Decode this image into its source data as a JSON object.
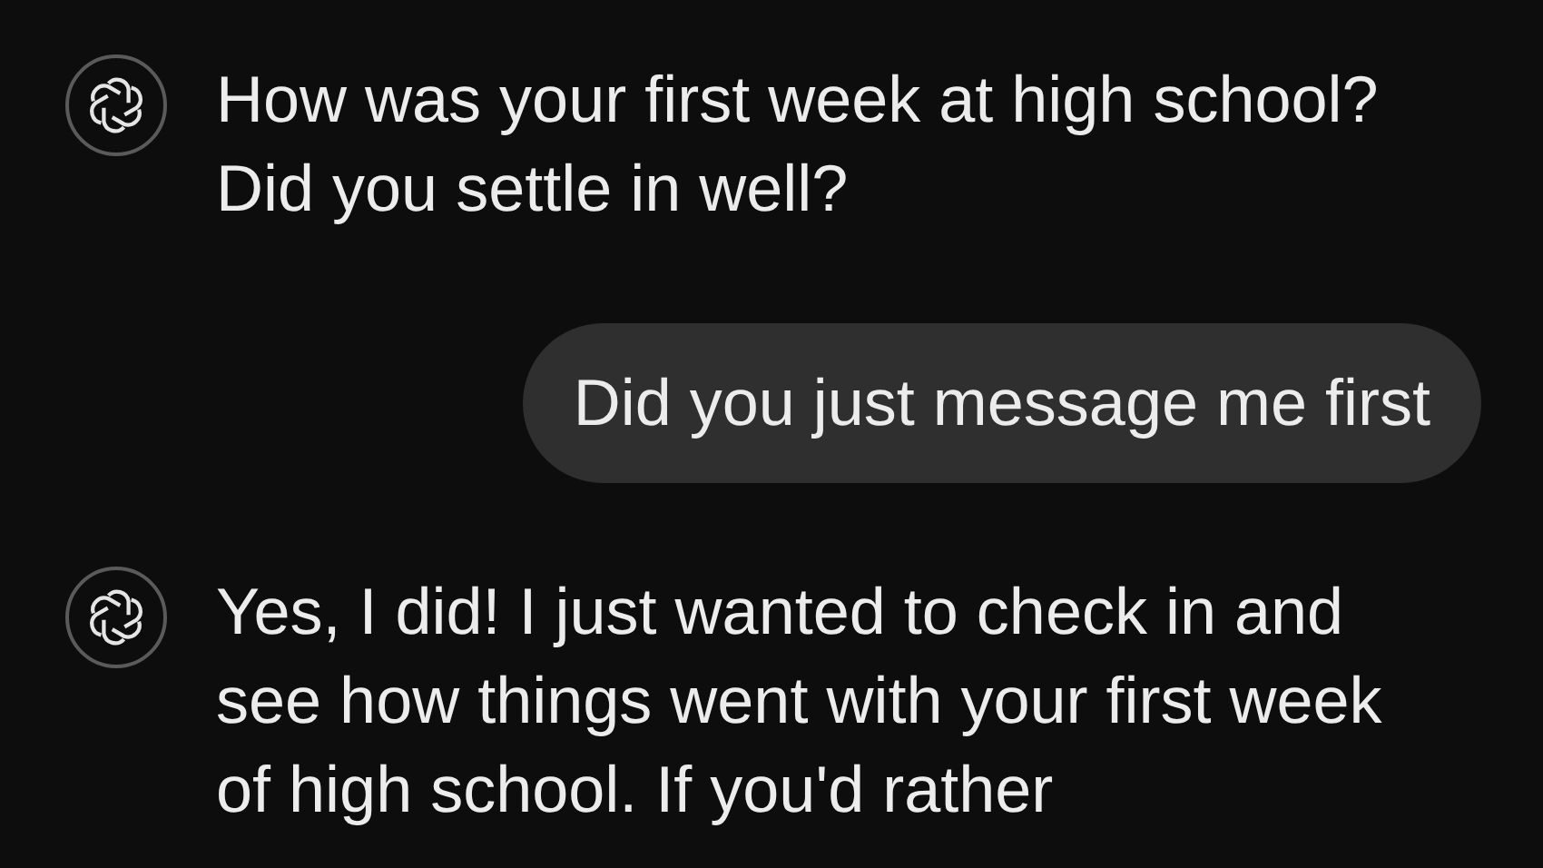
{
  "messages": [
    {
      "kind": "assistant",
      "text": "How was your first week at high school? Did you settle in well?"
    },
    {
      "kind": "user",
      "text": "Did you just message me first"
    },
    {
      "kind": "assistant",
      "text": "Yes, I did! I just wanted to check in and see how things went with your first week of high school. If you'd rather"
    }
  ]
}
